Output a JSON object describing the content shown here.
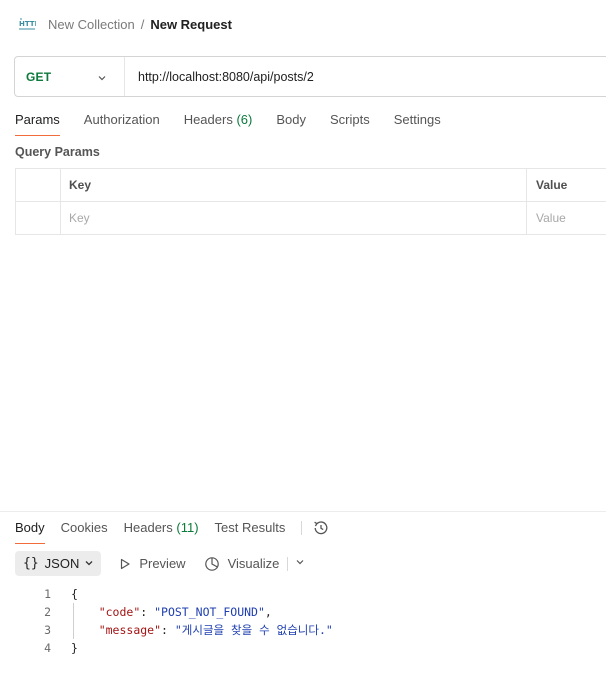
{
  "breadcrumb": {
    "icon": "http-icon",
    "collection": "New Collection",
    "separator": "/",
    "request": "New Request"
  },
  "request": {
    "method": "GET",
    "url": "http://localhost:8080/api/posts/2",
    "method_color": "#0b7a3a"
  },
  "request_tabs": [
    {
      "label": "Params",
      "active": true
    },
    {
      "label": "Authorization"
    },
    {
      "label": "Headers",
      "count": "(6)"
    },
    {
      "label": "Body"
    },
    {
      "label": "Scripts"
    },
    {
      "label": "Settings"
    }
  ],
  "query_params": {
    "title": "Query Params",
    "columns": {
      "key": "Key",
      "value": "Value"
    },
    "placeholders": {
      "key": "Key",
      "value": "Value"
    }
  },
  "response_tabs": [
    {
      "label": "Body",
      "active": true
    },
    {
      "label": "Cookies"
    },
    {
      "label": "Headers",
      "count": "(11)"
    },
    {
      "label": "Test Results"
    }
  ],
  "response_toolbar": {
    "format_braces": "{}",
    "format": "JSON",
    "preview": "Preview",
    "visualize": "Visualize"
  },
  "response_body": {
    "lines": [
      {
        "n": "1",
        "open": "{"
      },
      {
        "n": "2",
        "key": "\"code\"",
        "colon": ": ",
        "value": "\"POST_NOT_FOUND\"",
        "tail": ","
      },
      {
        "n": "3",
        "key": "\"message\"",
        "colon": ": ",
        "value": "\"게시글을 찾을 수 없습니다.\"",
        "tail": ""
      },
      {
        "n": "4",
        "close": "}"
      }
    ]
  },
  "colors": {
    "accent": "#f26b3a",
    "count": "#0b7a3a",
    "json_key": "#a31515",
    "json_string": "#1f3fb0"
  }
}
